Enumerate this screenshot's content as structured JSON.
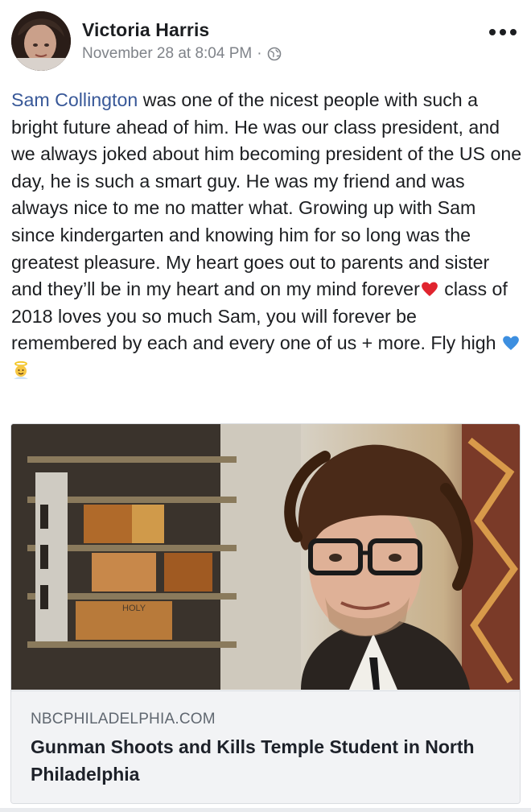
{
  "post": {
    "author_name": "Victoria Harris",
    "timestamp": "November 28 at 8:04 PM",
    "separator": "·",
    "privacy_icon": "globe-icon",
    "more_icon": "more-options-icon",
    "body": {
      "mention": "Sam Collington",
      "text_part1": " was one of the nicest people with such a bright future ahead of him. He was our class president, and we always joked about him becoming president of the US one day, he is such a smart guy. He was my friend and was always nice to me no matter what. Growing up with Sam since kindergarten and knowing him for so long was the greatest pleasure. My heart goes out to parents and sister and they’ll be in my heart and on my mind forever",
      "emoji_heart": "red-heart-emoji",
      "text_part2": " class of 2018 loves you so much Sam, you will forever be remembered by each and every one of us + more. Fly high ",
      "emoji_blue_heart": "blue-heart-emoji",
      "emoji_angel": "angel-emoji"
    }
  },
  "link_preview": {
    "domain": "NBCPHILADELPHIA.COM",
    "title": "Gunman Shoots and Kills Temple Student in North Philadelphia",
    "image_sign_text": "HOLY"
  },
  "colors": {
    "mention": "#385898",
    "text": "#1c1e21",
    "meta": "#7f8389",
    "card_bg": "#f2f3f5"
  }
}
